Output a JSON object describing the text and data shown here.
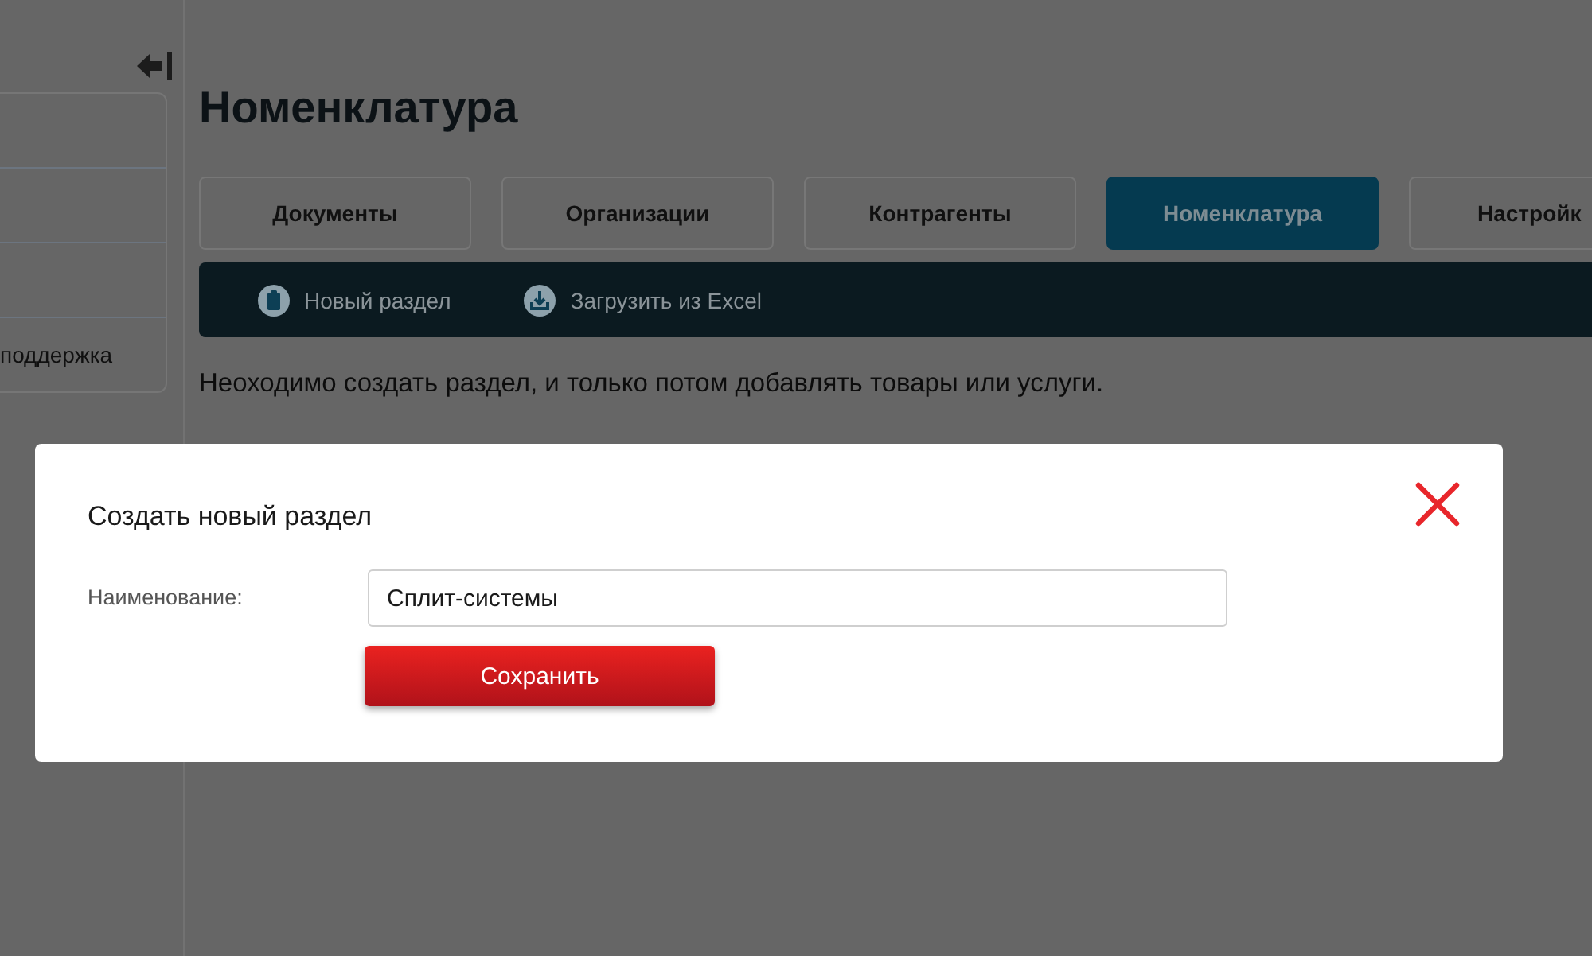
{
  "sidebar": {
    "items": [
      {
        "label": "поддержка"
      }
    ]
  },
  "page": {
    "title": "Номенклатура"
  },
  "tabs": [
    {
      "label": "Документы",
      "selected": false
    },
    {
      "label": "Организации",
      "selected": false
    },
    {
      "label": "Контрагенты",
      "selected": false
    },
    {
      "label": "Номенклатура",
      "selected": true
    },
    {
      "label": "Настройк",
      "selected": false
    }
  ],
  "toolbar": {
    "actions": [
      {
        "label": "Новый раздел",
        "kind": "new"
      },
      {
        "label": "Загрузить из Excel",
        "kind": "upload"
      }
    ]
  },
  "notice": "Неоходимо создать раздел, и только потом добавлять товары или услуги.",
  "dialog": {
    "title": "Создать новый раздел",
    "fields": [
      {
        "label": "Наименование:",
        "value": "Сплит-системы"
      }
    ],
    "buttons": [
      {
        "label": "Сохранить"
      }
    ]
  }
}
